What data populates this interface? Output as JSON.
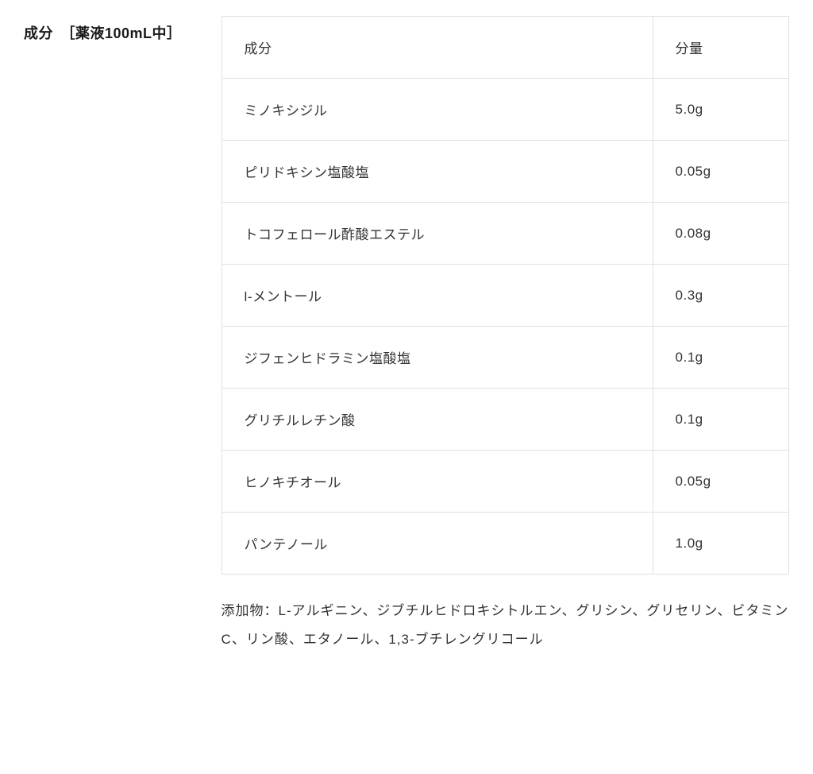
{
  "section_title": "成分　［薬液100mL中］",
  "table": {
    "header": {
      "ingredient": "成分",
      "amount": "分量"
    },
    "rows": [
      {
        "ingredient": "ミノキシジル",
        "amount": "5.0g"
      },
      {
        "ingredient": "ピリドキシン塩酸塩",
        "amount": "0.05g"
      },
      {
        "ingredient": "トコフェロール酢酸エステル",
        "amount": "0.08g"
      },
      {
        "ingredient": "l-メントール",
        "amount": "0.3g"
      },
      {
        "ingredient": "ジフェンヒドラミン塩酸塩",
        "amount": "0.1g"
      },
      {
        "ingredient": "グリチルレチン酸",
        "amount": "0.1g"
      },
      {
        "ingredient": "ヒノキチオール",
        "amount": "0.05g"
      },
      {
        "ingredient": "パンテノール",
        "amount": "1.0g"
      }
    ]
  },
  "additives": "添加物：L-アルギニン、ジブチルヒドロキシトルエン、グリシン、グリセリン、ビタミンC、リン酸、エタノール、1,3-ブチレングリコール"
}
